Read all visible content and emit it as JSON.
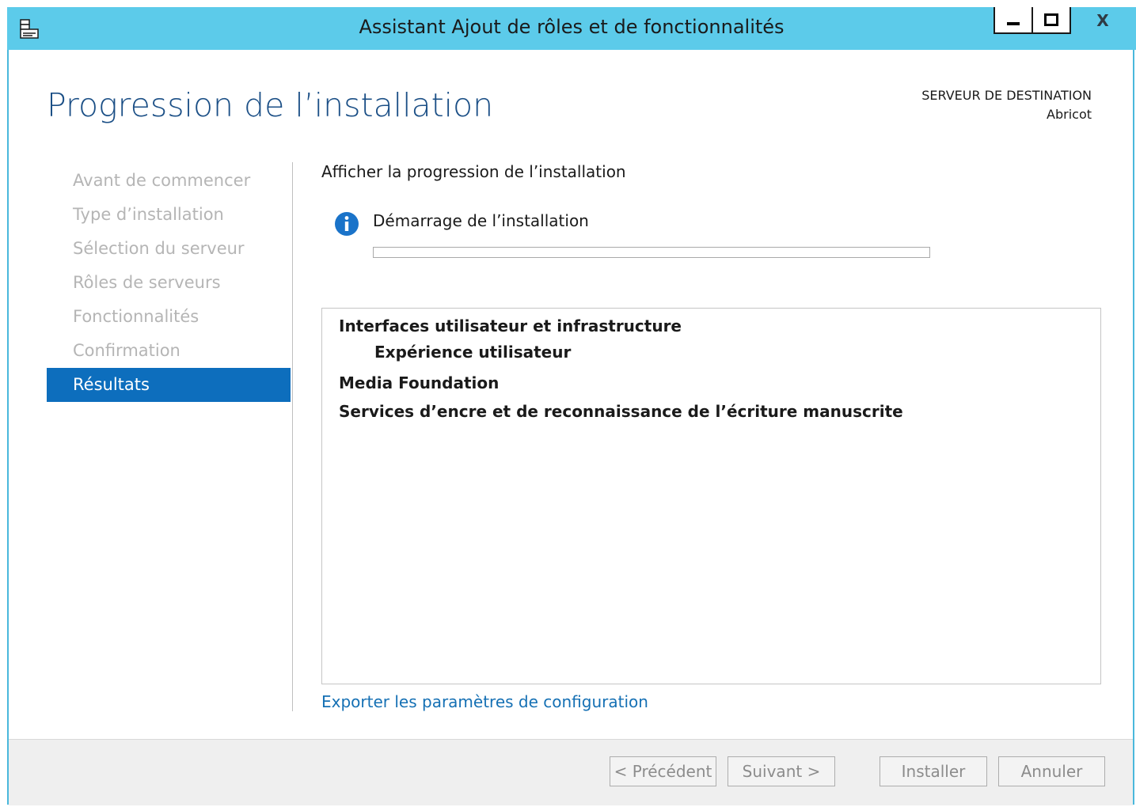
{
  "window": {
    "title": "Assistant Ajout de rôles et de fonctionnalités",
    "close_label": "X",
    "accent_color": "#5ccbea"
  },
  "header": {
    "page_title": "Progression de l’installation",
    "destination_label": "SERVEUR DE DESTINATION",
    "destination_server": "Abricot"
  },
  "nav": {
    "items": [
      {
        "label": "Avant de commencer"
      },
      {
        "label": "Type d’installation"
      },
      {
        "label": "Sélection du serveur"
      },
      {
        "label": "Rôles de serveurs"
      },
      {
        "label": "Fonctionnalités"
      },
      {
        "label": "Confirmation"
      },
      {
        "label": "Résultats"
      }
    ],
    "active_label": "Résultats",
    "active_color": "#0d6ebd"
  },
  "main": {
    "section_title": "Afficher la progression de l’installation",
    "status_icon": "info-icon",
    "status_text": "Démarrage de l’installation",
    "progress_percent": 0,
    "results": [
      {
        "label": "Interfaces utilisateur et infrastructure",
        "indent": 0
      },
      {
        "label": "Expérience utilisateur",
        "indent": 1
      },
      {
        "label": "Media Foundation",
        "indent": 0
      },
      {
        "label": "Services d’encre et de reconnaissance de l’écriture manuscrite",
        "indent": 0
      }
    ],
    "export_link": "Exporter les paramètres de configuration"
  },
  "footer": {
    "previous_label": "< Précédent",
    "next_label": "Suivant >",
    "install_label": "Installer",
    "cancel_label": "Annuler"
  }
}
